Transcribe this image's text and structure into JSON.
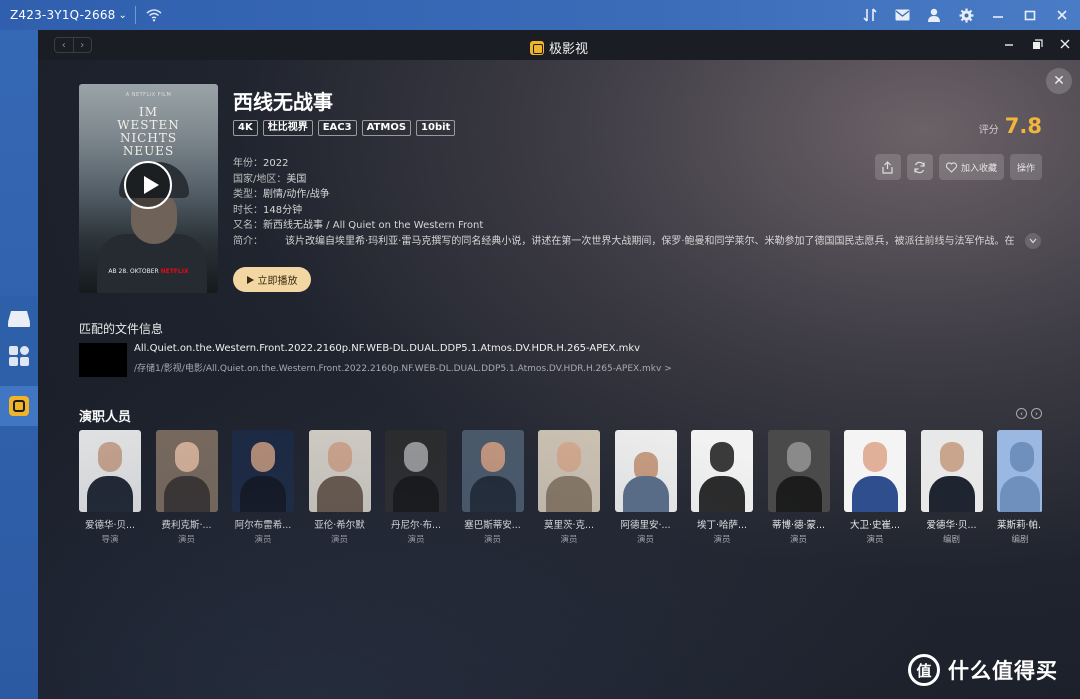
{
  "host": {
    "device_name": "Z423-3Y1Q-2668",
    "device_chevron": "⌄"
  },
  "window": {
    "title": "极影视",
    "nav_back": "‹",
    "nav_forward": "›",
    "close_round": "✕"
  },
  "movie": {
    "title": "西线无战事",
    "tags": [
      "4K",
      "杜比视界",
      "EAC3",
      "ATMOS",
      "10bit"
    ],
    "rating_label": "评分",
    "rating_value": "7.8",
    "year_label": "年份：",
    "year": "2022",
    "country_label": "国家/地区：",
    "country": "美国",
    "genre_label": "类型：",
    "genre": "剧情/动作/战争",
    "runtime_label": "时长：",
    "runtime": "148分钟",
    "aka_label": "又名：",
    "aka": "新西线无战事 / All Quiet on the Western Front",
    "synopsis_label": "简介：",
    "synopsis": "该片改编自埃里希·玛利亚·雷马克撰写的同名经典小说，讲述在第一次世界大战期间，保罗·鲍曼和同学莱尔、米勒参加了德国国民志愿兵，被派往前线与法军作战。在",
    "play_label": "立即播放",
    "poster": {
      "top_text": "A NETFLIX FILM",
      "title_lines": [
        "IM",
        "WESTEN",
        "NICHTS",
        "NEUES"
      ],
      "bottom_text": "AB 28. OKTOBER",
      "brand": "NETFLIX"
    }
  },
  "actions": {
    "collect_label": "加入收藏",
    "operate_label": "操作"
  },
  "file_info": {
    "section_title": "匹配的文件信息",
    "file_name": "All.Quiet.on.the.Western.Front.2022.2160p.NF.WEB-DL.DUAL.DDP5.1.Atmos.DV.HDR.H.265-APEX.mkv",
    "file_path": "/存储1/影视/电影/All.Quiet.on.the.Western.Front.2022.2160p.NF.WEB-DL.DUAL.DDP5.1.Atmos.DV.HDR.H.265-APEX.mkv >"
  },
  "cast": {
    "section_title": "演职人员",
    "members": [
      {
        "name": "爱德华·贝...",
        "role": "导演"
      },
      {
        "name": "费利克斯·...",
        "role": "演员"
      },
      {
        "name": "阿尔布雷希...",
        "role": "演员"
      },
      {
        "name": "亚伦·希尔默",
        "role": "演员"
      },
      {
        "name": "丹尼尔·布...",
        "role": "演员"
      },
      {
        "name": "塞巴斯蒂安...",
        "role": "演员"
      },
      {
        "name": "莫里茨·克...",
        "role": "演员"
      },
      {
        "name": "阿德里安·...",
        "role": "演员"
      },
      {
        "name": "埃丁·哈萨...",
        "role": "演员"
      },
      {
        "name": "蒂博·德·蒙...",
        "role": "演员"
      },
      {
        "name": "大卫·史崔...",
        "role": "演员"
      },
      {
        "name": "爱德华·贝...",
        "role": "编剧"
      },
      {
        "name": "莱斯莉·帕...",
        "role": "编剧"
      }
    ]
  },
  "watermark": {
    "badge": "值",
    "text": "什么值得买"
  }
}
